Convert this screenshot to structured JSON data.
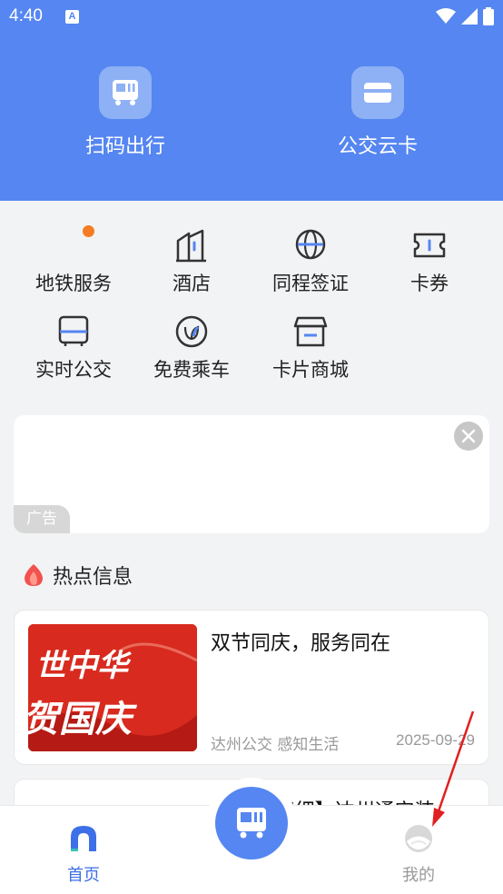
{
  "status_bar": {
    "time": "4:40",
    "app_icon_letter": "A"
  },
  "top_actions": [
    {
      "label": "扫码出行",
      "icon": "bus-qr-icon"
    },
    {
      "label": "公交云卡",
      "icon": "card-icon"
    }
  ],
  "services": [
    {
      "label": "地铁服务",
      "icon": "subway-icon",
      "badge": true
    },
    {
      "label": "酒店",
      "icon": "hotel-icon"
    },
    {
      "label": "同程签证",
      "icon": "globe-icon"
    },
    {
      "label": "卡券",
      "icon": "ticket-icon"
    },
    {
      "label": "实时公交",
      "icon": "bus-icon"
    },
    {
      "label": "免费乘车",
      "icon": "leaf-icon"
    },
    {
      "label": "卡片商城",
      "icon": "store-icon"
    }
  ],
  "ad": {
    "tag": "广告"
  },
  "hot_section": {
    "title": "热点信息"
  },
  "news": [
    {
      "title": "双节同庆，服务同在",
      "source": "达州公交 感知生活",
      "date": "2025-09-29",
      "thumb_text_1": "世中华",
      "thumb_text_2": "贺国庆"
    },
    {
      "title_partial": "]细】达州通安装"
    }
  ],
  "bottom_nav": {
    "home_label": "首页",
    "mine_label": "我的"
  },
  "colors": {
    "brand": "#5586f1",
    "badge": "#f57c22",
    "arrow": "#e02020"
  }
}
